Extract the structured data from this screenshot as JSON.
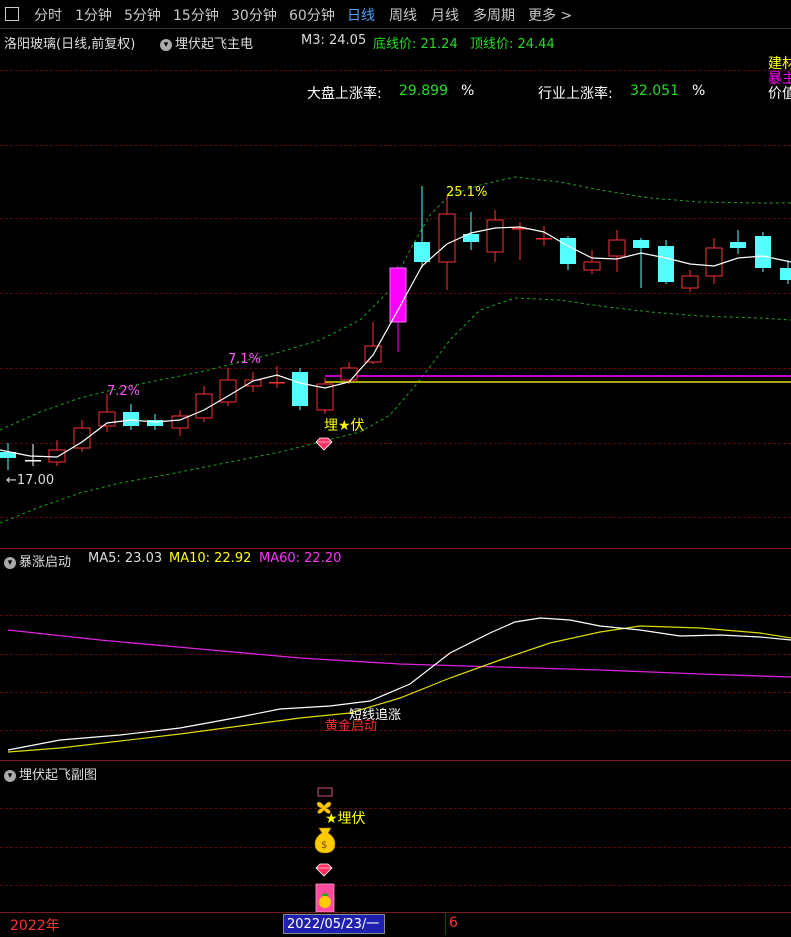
{
  "toolbar": {
    "periods": [
      "分时",
      "1分钟",
      "5分钟",
      "15分钟",
      "30分钟",
      "60分钟",
      "日线",
      "周线",
      "月线",
      "多周期",
      "更多 >"
    ],
    "active": "日线"
  },
  "main_panel": {
    "title": "洛阳玻璃(日线,前复权)",
    "indicator": "埋伏起飞主电",
    "m3_label": "M3: 24.05",
    "bottom_label": "底线价: 21.24",
    "top_label": "顶线价: 24.44",
    "market_label": "大盘上涨率:",
    "market_value": "29.899",
    "industry_label": "行业上涨率:",
    "industry_value": "32.051",
    "pct_sign": "%",
    "right_cut_1": "建材",
    "right_cut_2": "暴主",
    "right_cut_3": "价值",
    "ann_25": "25.1%",
    "ann_71": "7.1%",
    "ann_72": "7.2%",
    "low_label": "←17.00",
    "ambush_label": "埋★伏"
  },
  "sub_panel1": {
    "title": "暴涨启动",
    "ma5": "MA5: 23.03",
    "ma10": "MA10: 22.92",
    "ma60": "MA60: 22.20",
    "ann_chase": "短线追涨",
    "ann_gold": "黄金启动"
  },
  "sub_panel2": {
    "title": "埋伏起飞副图",
    "ambush_label": "★埋伏"
  },
  "bottom_bar": {
    "year": "2022年",
    "date": "2022/05/23/一",
    "marker": "6"
  },
  "colors": {
    "up": "#ff3232",
    "down": "#54ffff",
    "magenta": "#ff00ff",
    "yellow": "#ffff00",
    "green": "#22dd22",
    "white": "#ffffff"
  }
}
